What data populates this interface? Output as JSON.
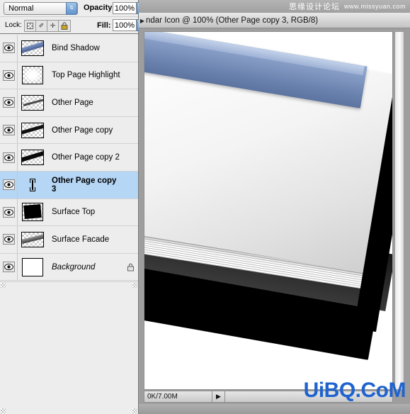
{
  "layers_panel": {
    "blend_mode": {
      "value": "Normal",
      "arrows_glyph": "⇅"
    },
    "opacity": {
      "label": "Opacity:",
      "value": "100%",
      "arrow_glyph": "▶"
    },
    "fill": {
      "label": "Fill:",
      "value": "100%",
      "arrow_glyph": "▶"
    },
    "lock": {
      "label": "Lock:",
      "icons": [
        {
          "name": "lock-transparency-icon",
          "glyph": ""
        },
        {
          "name": "lock-pixels-icon",
          "glyph": "✐"
        },
        {
          "name": "lock-position-icon",
          "glyph": "✛"
        },
        {
          "name": "lock-all-icon",
          "glyph": "🔒"
        }
      ]
    },
    "layers": [
      {
        "name": "Bind Shadow",
        "visible": true,
        "selected": false,
        "locked": false,
        "italic": false,
        "art": "art-diag-blue"
      },
      {
        "name": "Top Page Highlight",
        "visible": true,
        "selected": false,
        "locked": false,
        "italic": false,
        "art": "art-cloud"
      },
      {
        "name": "Other Page",
        "visible": true,
        "selected": false,
        "locked": false,
        "italic": false,
        "art": "art-diag-thin"
      },
      {
        "name": "Other Page copy",
        "visible": true,
        "selected": false,
        "locked": false,
        "italic": false,
        "art": "art-diag-thick"
      },
      {
        "name": "Other Page copy 2",
        "visible": true,
        "selected": false,
        "locked": false,
        "italic": false,
        "art": "art-diag-thick2"
      },
      {
        "name": "Other Page copy 3",
        "visible": true,
        "selected": true,
        "locked": false,
        "italic": false,
        "art": "art-diag-thick2"
      },
      {
        "name": "Surface Top",
        "visible": true,
        "selected": false,
        "locked": false,
        "italic": false,
        "art": "art-blackbox"
      },
      {
        "name": "Surface Facade",
        "visible": true,
        "selected": false,
        "locked": false,
        "italic": false,
        "art": "art-facade"
      },
      {
        "name": "Background",
        "visible": true,
        "selected": false,
        "locked": true,
        "italic": true,
        "art": "art-white"
      }
    ],
    "selected_row_color": "#b5d6f5",
    "panel_bg_color": "#ededed"
  },
  "document_window": {
    "title": "ndar Icon @ 100% (Other Page copy 3, RGB/8)",
    "title_arrow_glyph": "▶",
    "status_text": "0K/7.00M",
    "status_arrow_glyph": "▶"
  },
  "watermark": {
    "chinese": "思缘设计论坛",
    "english": "www.missyuan.com"
  },
  "logo": {
    "text": "UiBQ.CoM",
    "color": "#1f63cf"
  }
}
